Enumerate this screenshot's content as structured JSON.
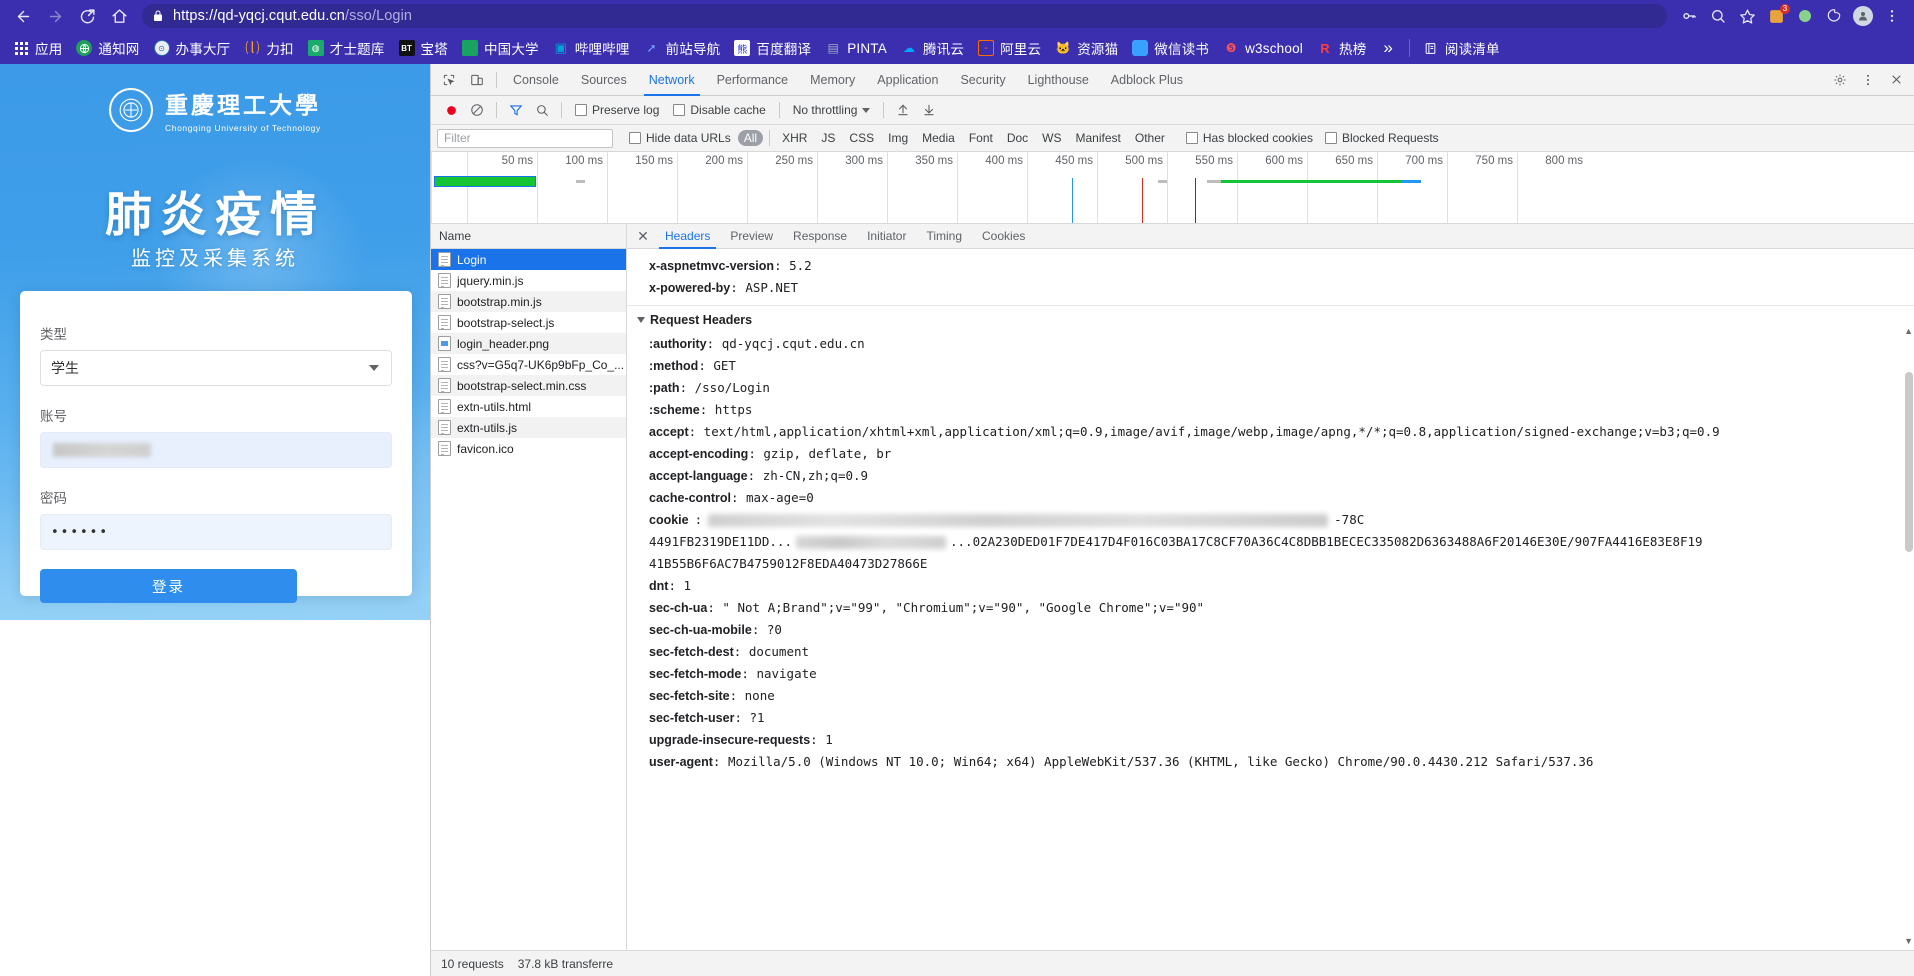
{
  "browser": {
    "nav": {
      "back_icon": "arrow-left-icon",
      "forward_icon": "arrow-right-icon",
      "reload_icon": "reload-icon",
      "home_icon": "home-icon"
    },
    "omnibox": {
      "lock_icon": "lock-icon",
      "url_secure": "https://qd-yqcj.cqut.edu.cn",
      "url_path": "/sso/Login",
      "full_url": "https://qd-yqcj.cqut.edu.cn/sso/Login"
    },
    "omnibox_right": [
      {
        "name": "password-key-icon",
        "glyph": "⚷"
      },
      {
        "name": "search-icon",
        "glyph": "⌕"
      },
      {
        "name": "bookmark-star-icon",
        "glyph": "☆"
      }
    ],
    "toolbar_right": [
      {
        "name": "extension-badge-icon",
        "badge": "3"
      },
      {
        "name": "puzzle-extension-icon"
      },
      {
        "name": "colored-extension-icon"
      },
      {
        "name": "profile-avatar-icon"
      },
      {
        "name": "chrome-menu-icon",
        "glyph": "⋮"
      }
    ],
    "bookmarks": [
      {
        "label": "应用",
        "icon": "apps-grid-icon",
        "color": "#ffffff"
      },
      {
        "label": "通知网",
        "icon": "globe-icon",
        "color": "#1ea05a"
      },
      {
        "label": "办事大厅",
        "icon": "hall-icon",
        "color": "#2b6cb0"
      },
      {
        "label": "力扣",
        "icon": "leetcode-icon",
        "color": "#f89f1b"
      },
      {
        "label": "才士题库",
        "icon": "caishi-icon",
        "color": "#1bac6d"
      },
      {
        "label": "宝塔",
        "icon": "bt-panel-icon",
        "color": "#111111"
      },
      {
        "label": "中国大学",
        "icon": "mooc-icon",
        "color": "#1aa260"
      },
      {
        "label": "哔哩哔哩",
        "icon": "bilibili-icon",
        "color": "#00a1d6"
      },
      {
        "label": "前站导航",
        "icon": "nav-rocket-icon",
        "color": "#3b6fe0"
      },
      {
        "label": "百度翻译",
        "icon": "baidu-icon",
        "color": "#2932e1"
      },
      {
        "label": "PINTA",
        "icon": "pinta-icon",
        "color": "#7a8b99"
      },
      {
        "label": "腾讯云",
        "icon": "tencent-cloud-icon",
        "color": "#00a4ff"
      },
      {
        "label": "阿里云",
        "icon": "aliyun-icon",
        "color": "#ff6a00"
      },
      {
        "label": "资源猫",
        "icon": "cat-icon",
        "color": "#ffd23f"
      },
      {
        "label": "微信读书",
        "icon": "wechat-read-icon",
        "color": "#3aa0ff"
      },
      {
        "label": "w3school",
        "icon": "w3school-icon",
        "color": "#ff4f4f"
      },
      {
        "label": "热榜",
        "icon": "hot-list-icon",
        "color": "#ff3b3b"
      }
    ],
    "bookmarks_overflow": "»",
    "reading_list": {
      "label": "阅读清单",
      "icon": "reading-list-icon"
    }
  },
  "webpage": {
    "university": {
      "seal_text": "重庆理工大学",
      "name_cn": "重慶理工大學",
      "name_en": "Chongqing University of Technology"
    },
    "hero_title": "肺炎疫情",
    "hero_subtitle": "监控及采集系统",
    "form": {
      "type_label": "类型",
      "type_value": "学生",
      "type_caret_icon": "chevron-down-icon",
      "account_label": "账号",
      "account_value": "",
      "password_label": "密码",
      "password_value": "••••••",
      "submit_label": "登录"
    }
  },
  "devtools": {
    "toolbar_icons": {
      "inspect": "inspect-element-icon",
      "device": "device-toolbar-icon",
      "settings": "gear-icon",
      "more": "more-vertical-icon",
      "close": "close-icon"
    },
    "tabs": [
      {
        "label": "Console",
        "active": false
      },
      {
        "label": "Sources",
        "active": false
      },
      {
        "label": "Network",
        "active": true
      },
      {
        "label": "Performance",
        "active": false
      },
      {
        "label": "Memory",
        "active": false
      },
      {
        "label": "Application",
        "active": false
      },
      {
        "label": "Security",
        "active": false
      },
      {
        "label": "Lighthouse",
        "active": false
      },
      {
        "label": "Adblock Plus",
        "active": false
      }
    ],
    "network_toolbar": {
      "record_icon": "record-red-icon",
      "clear_icon": "clear-no-entry-icon",
      "filter_icon": "funnel-filter-icon",
      "search_icon": "search-icon",
      "preserve_log": "Preserve log",
      "disable_cache": "Disable cache",
      "throttling": "No throttling",
      "throttle_caret_icon": "chevron-down-icon",
      "import_icon": "import-arrow-up-icon",
      "export_icon": "export-arrow-down-icon"
    },
    "filter_bar": {
      "filter_placeholder": "Filter",
      "hide_data_urls": "Hide data URLs",
      "types": [
        "All",
        "XHR",
        "JS",
        "CSS",
        "Img",
        "Media",
        "Font",
        "Doc",
        "WS",
        "Manifest",
        "Other"
      ],
      "active_type": "All",
      "has_blocked_cookies": "Has blocked cookies",
      "blocked_requests": "Blocked Requests"
    },
    "timeline_ticks": [
      "50 ms",
      "100 ms",
      "150 ms",
      "200 ms",
      "250 ms",
      "300 ms",
      "350 ms",
      "400 ms",
      "450 ms",
      "500 ms",
      "550 ms",
      "600 ms",
      "650 ms",
      "700 ms",
      "750 ms",
      "800 ms"
    ],
    "requests_header": "Name",
    "requests": [
      {
        "name": "Login",
        "type": "doc",
        "selected": true
      },
      {
        "name": "jquery.min.js",
        "type": "script",
        "selected": false
      },
      {
        "name": "bootstrap.min.js",
        "type": "script",
        "selected": false
      },
      {
        "name": "bootstrap-select.js",
        "type": "script",
        "selected": false
      },
      {
        "name": "login_header.png",
        "type": "image",
        "selected": false
      },
      {
        "name": "css?v=G5q7-UK6p9bFp_Co_...",
        "type": "style",
        "selected": false
      },
      {
        "name": "bootstrap-select.min.css",
        "type": "style",
        "selected": false
      },
      {
        "name": "extn-utils.html",
        "type": "doc",
        "selected": false
      },
      {
        "name": "extn-utils.js",
        "type": "script",
        "selected": false
      },
      {
        "name": "favicon.ico",
        "type": "image",
        "selected": false
      }
    ],
    "detail_tabs": [
      {
        "label": "Headers",
        "active": true
      },
      {
        "label": "Preview",
        "active": false
      },
      {
        "label": "Response",
        "active": false
      },
      {
        "label": "Initiator",
        "active": false
      },
      {
        "label": "Timing",
        "active": false
      },
      {
        "label": "Cookies",
        "active": false
      }
    ],
    "response_headers_tail": [
      {
        "key": "x-aspnetmvc-version",
        "value": "5.2"
      },
      {
        "key": "x-powered-by",
        "value": "ASP.NET"
      }
    ],
    "request_headers_section": "Request Headers",
    "request_headers": [
      {
        "key": ":authority",
        "value": "qd-yqcj.cqut.edu.cn"
      },
      {
        "key": ":method",
        "value": "GET"
      },
      {
        "key": ":path",
        "value": "/sso/Login"
      },
      {
        "key": ":scheme",
        "value": "https"
      },
      {
        "key": "accept",
        "value": "text/html,application/xhtml+xml,application/xml;q=0.9,image/avif,image/webp,image/apng,*/*;q=0.8,application/signed-exchange;v=b3;q=0.9"
      },
      {
        "key": "accept-encoding",
        "value": "gzip, deflate, br"
      },
      {
        "key": "accept-language",
        "value": "zh-CN,zh;q=0.9"
      },
      {
        "key": "cache-control",
        "value": "max-age=0"
      },
      {
        "key": "cookie",
        "value": "",
        "redacted": true,
        "tail": "-78C"
      },
      {
        "key": "",
        "value": "4491FB2319DE11DD...",
        "redacted_inline": true,
        "tail": "...02A230DED01F7DE417D4F016C03BA17C8CF70A36C4C8DBB1BECEC335082D6363488A6F20146E30E/907FA4416E83E8F19"
      },
      {
        "key": "",
        "value": "41B55B6F6AC7B4759012F8EDA40473D27866E"
      },
      {
        "key": "dnt",
        "value": "1"
      },
      {
        "key": "sec-ch-ua",
        "value": "\" Not A;Brand\";v=\"99\", \"Chromium\";v=\"90\", \"Google Chrome\";v=\"90\""
      },
      {
        "key": "sec-ch-ua-mobile",
        "value": "?0"
      },
      {
        "key": "sec-fetch-dest",
        "value": "document"
      },
      {
        "key": "sec-fetch-mode",
        "value": "navigate"
      },
      {
        "key": "sec-fetch-site",
        "value": "none"
      },
      {
        "key": "sec-fetch-user",
        "value": "?1"
      },
      {
        "key": "upgrade-insecure-requests",
        "value": "1"
      },
      {
        "key": "user-agent",
        "value": "Mozilla/5.0 (Windows NT 10.0; Win64; x64) AppleWebKit/537.36 (KHTML, like Gecko) Chrome/90.0.4430.212 Safari/537.36"
      }
    ],
    "status_bar": {
      "requests": "10 requests",
      "transferred": "37.8 kB transferre"
    }
  },
  "colors": {
    "chrome_purple": "#3b2fb0",
    "devtools_blue": "#1a73e8",
    "page_blue": "#3c9ae8",
    "record_red": "#e8001d",
    "waterfall_green": "#14c434"
  }
}
